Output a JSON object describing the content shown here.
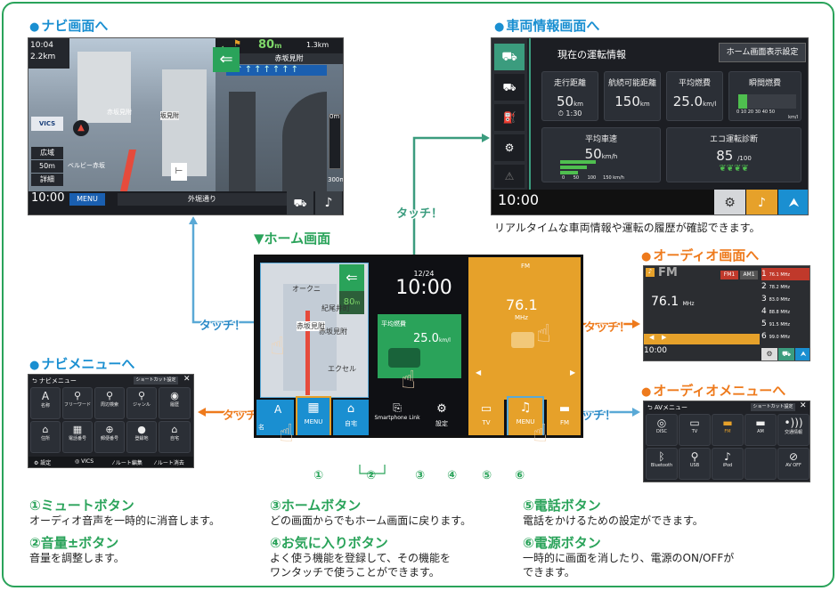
{
  "headings": {
    "navi_screen": "ナビ画面へ",
    "vehicle_screen": "車両情報画面へ",
    "home_screen": "▼ホーム画面",
    "audio_screen": "オーディオ画面へ",
    "navi_menu": "ナビメニューへ",
    "audio_menu": "オーディオメニューへ"
  },
  "touch_label": "タッチ！",
  "vehicle_caption": "リアルタイムな車両情報や運転の履歴が確認できます。",
  "navi": {
    "time": "10:04",
    "scale": "2.2km",
    "distance": "80",
    "distance_unit": "m",
    "next_distance": "1.3km",
    "place": "赤坂見附",
    "place_small": "赤坂見附",
    "place_small2": "坂見附",
    "vics": "VICS",
    "btn_wide": "広域",
    "btn_scale": "50m",
    "btn_detail": "詳細",
    "clock": "10:00",
    "menu": "MENU",
    "road": "外堀通り",
    "road_left": "ベルビー赤坂",
    "scale_right": "300m",
    "zero_m": "0m"
  },
  "vehicle": {
    "title": "現在の運転情報",
    "btn": "ホーム画面表示設定",
    "cards": [
      {
        "label": "走行距離",
        "value": "50",
        "unit": "km",
        "sub": "1:30"
      },
      {
        "label": "航続可能距離",
        "value": "150",
        "unit": "km"
      },
      {
        "label": "平均燃費",
        "value": "25.0",
        "unit": "km/l"
      },
      {
        "label": "瞬間燃費"
      }
    ],
    "avg_speed_label": "平均車速",
    "avg_speed": "50",
    "avg_speed_unit": "km/h",
    "eco_label": "エコ運転診断",
    "eco_score": "85",
    "eco_max": "/100",
    "clock": "10:00",
    "ticks_speed": [
      "0",
      "50",
      "100",
      "150 km/h"
    ],
    "ticks_fuel": [
      "0",
      "10",
      "20",
      "30",
      "40",
      "50"
    ],
    "fuel_unit": "km/l"
  },
  "home": {
    "date": "12/24",
    "time": "10:00",
    "fuel_label": "平均燃費",
    "fuel_value": "25.0",
    "fuel_unit": "km/l",
    "fm": "FM",
    "freq": "76.1",
    "mhz": "MHz",
    "map_place1": "オークニ",
    "map_place2": "紀尾井町",
    "map_place3": "赤坂見附",
    "map_place4": "赤坂見附",
    "map_place5": "エクセル",
    "map_dist": "80",
    "map_dist_unit": "m",
    "btns": [
      "MENU",
      "自宅",
      "Smartphone Link",
      "設定",
      "TV",
      "MENU",
      "FM"
    ],
    "left_small": "名",
    "a_label": "A"
  },
  "audio": {
    "fm": "FM",
    "freq": "76.1",
    "mhz": "MHz",
    "fm1": "FM1",
    "am1": "AM1",
    "presets": [
      {
        "n": "1",
        "f": "76.1 MHz"
      },
      {
        "n": "2",
        "f": "78.2 MHz"
      },
      {
        "n": "3",
        "f": "83.0 MHz"
      },
      {
        "n": "4",
        "f": "88.8 MHz"
      },
      {
        "n": "5",
        "f": "91.5 MHz"
      },
      {
        "n": "6",
        "f": "99.0 MHz"
      }
    ],
    "clock": "10:00"
  },
  "navi_menu": {
    "title": "ナビメニュー",
    "shortcut": "ショートカット設定",
    "items": [
      "名称",
      "フリーワード",
      "周辺検索",
      "ジャンル",
      "履歴",
      "住所",
      "電話番号",
      "郵便番号",
      "登録地",
      "自宅"
    ],
    "footer": [
      "設定",
      "VICS",
      "ルート編集",
      "ルート消去"
    ]
  },
  "audio_menu": {
    "title": "AVメニュー",
    "shortcut": "ショートカット設定",
    "items": [
      "DISC",
      "TV",
      "FM",
      "AM",
      "交通情報",
      "Bluetooth",
      "USB",
      "iPod",
      "",
      "AV OFF"
    ]
  },
  "numbers": [
    "①",
    "②",
    "③",
    "④",
    "⑤",
    "⑥"
  ],
  "legend": [
    {
      "title": "①ミュートボタン",
      "text": [
        "オーディオ音声を一時的に消音します。"
      ]
    },
    {
      "title": "②音量±ボタン",
      "text": [
        "音量を調整します。"
      ]
    },
    {
      "title": "③ホームボタン",
      "text": [
        "どの画面からでもホーム画面に戻ります。"
      ]
    },
    {
      "title": "④お気に入りボタン",
      "text": [
        "よく使う機能を登録して、その機能を",
        "ワンタッチで使うことができます。"
      ]
    },
    {
      "title": "⑤電話ボタン",
      "text": [
        "電話をかけるための設定ができます。"
      ]
    },
    {
      "title": "⑥電源ボタン",
      "text": [
        "一時的に画面を消したり、電源のON/OFFが",
        "できます。"
      ]
    }
  ],
  "colors": {
    "green": "#2aa35a",
    "blue": "#1a8fd1",
    "orange": "#ee7a1c",
    "teal": "#3b9c7e",
    "fm_orange": "#e6a12a",
    "navy": "#1a5fb0"
  }
}
